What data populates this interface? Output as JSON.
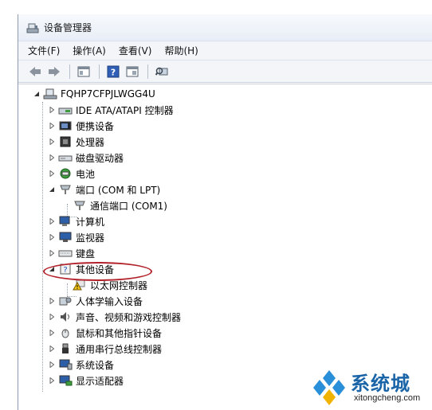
{
  "window": {
    "title": "设备管理器"
  },
  "menu": [
    {
      "label": "文件(F)"
    },
    {
      "label": "操作(A)"
    },
    {
      "label": "查看(V)"
    },
    {
      "label": "帮助(H)"
    }
  ],
  "tree": {
    "root": "FQHP7CFPJLWGG4U",
    "items": [
      {
        "label": "IDE ATA/ATAPI 控制器",
        "icon": "ide-controller-icon"
      },
      {
        "label": "便携设备",
        "icon": "portable-device-icon"
      },
      {
        "label": "处理器",
        "icon": "processor-icon"
      },
      {
        "label": "磁盘驱动器",
        "icon": "disk-drive-icon"
      },
      {
        "label": "电池",
        "icon": "battery-icon"
      },
      {
        "label": "端口 (COM 和 LPT)",
        "icon": "port-icon",
        "children": [
          {
            "label": "通信端口 (COM1)",
            "icon": "port-icon"
          }
        ]
      },
      {
        "label": "计算机",
        "icon": "computer-icon"
      },
      {
        "label": "监视器",
        "icon": "monitor-icon"
      },
      {
        "label": "键盘",
        "icon": "keyboard-icon"
      },
      {
        "label": "其他设备",
        "icon": "unknown-device-icon",
        "children": [
          {
            "label": "以太网控制器",
            "icon": "warning-device-icon"
          }
        ]
      },
      {
        "label": "人体学输入设备",
        "icon": "hid-icon"
      },
      {
        "label": "声音、视频和游戏控制器",
        "icon": "sound-icon"
      },
      {
        "label": "鼠标和其他指针设备",
        "icon": "mouse-icon"
      },
      {
        "label": "通用串行总线控制器",
        "icon": "usb-icon"
      },
      {
        "label": "系统设备",
        "icon": "system-device-icon"
      },
      {
        "label": "显示适配器",
        "icon": "display-adapter-icon"
      }
    ]
  },
  "watermark": {
    "brand": "系统城",
    "url": "xitongcheng.com"
  }
}
